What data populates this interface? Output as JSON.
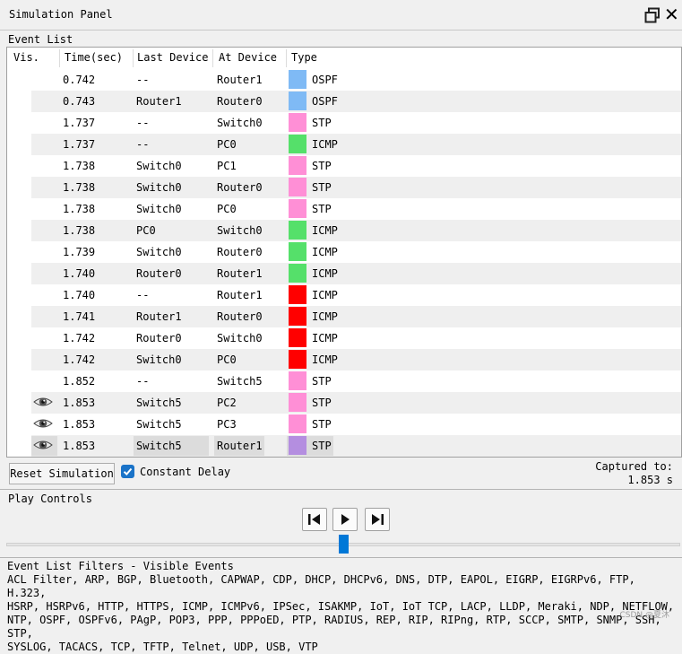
{
  "window": {
    "title": "Simulation Panel"
  },
  "event_list": {
    "label": "Event List",
    "columns": [
      "Vis.",
      "Time(sec)",
      "Last Device",
      "At Device",
      "Type"
    ],
    "rows": [
      {
        "time": "0.742",
        "last": "--",
        "at": "Router1",
        "type": "OSPF",
        "color": "#7fbaf5",
        "eye": false,
        "selected": false
      },
      {
        "time": "0.743",
        "last": "Router1",
        "at": "Router0",
        "type": "OSPF",
        "color": "#7fbaf5",
        "eye": false,
        "selected": false
      },
      {
        "time": "1.737",
        "last": "--",
        "at": "Switch0",
        "type": "STP",
        "color": "#ff8fd6",
        "eye": false,
        "selected": false
      },
      {
        "time": "1.737",
        "last": "--",
        "at": "PC0",
        "type": "ICMP",
        "color": "#55e06a",
        "eye": false,
        "selected": false
      },
      {
        "time": "1.738",
        "last": "Switch0",
        "at": "PC1",
        "type": "STP",
        "color": "#ff8fd6",
        "eye": false,
        "selected": false
      },
      {
        "time": "1.738",
        "last": "Switch0",
        "at": "Router0",
        "type": "STP",
        "color": "#ff8fd6",
        "eye": false,
        "selected": false
      },
      {
        "time": "1.738",
        "last": "Switch0",
        "at": "PC0",
        "type": "STP",
        "color": "#ff8fd6",
        "eye": false,
        "selected": false
      },
      {
        "time": "1.738",
        "last": "PC0",
        "at": "Switch0",
        "type": "ICMP",
        "color": "#55e06a",
        "eye": false,
        "selected": false
      },
      {
        "time": "1.739",
        "last": "Switch0",
        "at": "Router0",
        "type": "ICMP",
        "color": "#55e06a",
        "eye": false,
        "selected": false
      },
      {
        "time": "1.740",
        "last": "Router0",
        "at": "Router1",
        "type": "ICMP",
        "color": "#55e06a",
        "eye": false,
        "selected": false
      },
      {
        "time": "1.740",
        "last": "--",
        "at": "Router1",
        "type": "ICMP",
        "color": "#ff0000",
        "eye": false,
        "selected": false
      },
      {
        "time": "1.741",
        "last": "Router1",
        "at": "Router0",
        "type": "ICMP",
        "color": "#ff0000",
        "eye": false,
        "selected": false
      },
      {
        "time": "1.742",
        "last": "Router0",
        "at": "Switch0",
        "type": "ICMP",
        "color": "#ff0000",
        "eye": false,
        "selected": false
      },
      {
        "time": "1.742",
        "last": "Switch0",
        "at": "PC0",
        "type": "ICMP",
        "color": "#ff0000",
        "eye": false,
        "selected": false
      },
      {
        "time": "1.852",
        "last": "--",
        "at": "Switch5",
        "type": "STP",
        "color": "#ff8fd6",
        "eye": false,
        "selected": false
      },
      {
        "time": "1.853",
        "last": "Switch5",
        "at": "PC2",
        "type": "STP",
        "color": "#ff8fd6",
        "eye": true,
        "selected": false
      },
      {
        "time": "1.853",
        "last": "Switch5",
        "at": "PC3",
        "type": "STP",
        "color": "#ff8fd6",
        "eye": true,
        "selected": false
      },
      {
        "time": "1.853",
        "last": "Switch5",
        "at": "Router1",
        "type": "STP",
        "color": "#b48ee0",
        "eye": true,
        "selected": true
      }
    ]
  },
  "controls": {
    "reset_label": "Reset Simulation",
    "constant_delay_label": "Constant Delay",
    "constant_delay_checked": true,
    "captured_label": "Captured to:",
    "captured_value": "1.853 s"
  },
  "play": {
    "label": "Play Controls",
    "slider_position": 0.5
  },
  "filters": {
    "label": "Event List Filters - Visible Events",
    "line1": "ACL Filter, ARP, BGP, Bluetooth, CAPWAP, CDP, DHCP, DHCPv6, DNS, DTP, EAPOL, EIGRP, EIGRPv6, FTP, H.323,",
    "line2": "HSRP, HSRPv6, HTTP, HTTPS, ICMP, ICMPv6, IPSec, ISAKMP, IoT, IoT TCP, LACP, LLDP, Meraki, NDP, NETFLOW,",
    "line3": "NTP, OSPF, OSPFv6, PAgP, POP3, PPP, PPPoED, PTP, RADIUS, REP, RIP, RIPng, RTP, SCCP, SMTP, SNMP, SSH, STP,",
    "line4": "SYSLOG, TACACS, TCP, TFTP, Telnet, UDP, USB, VTP"
  },
  "watermark": "CSDN @夏沐"
}
